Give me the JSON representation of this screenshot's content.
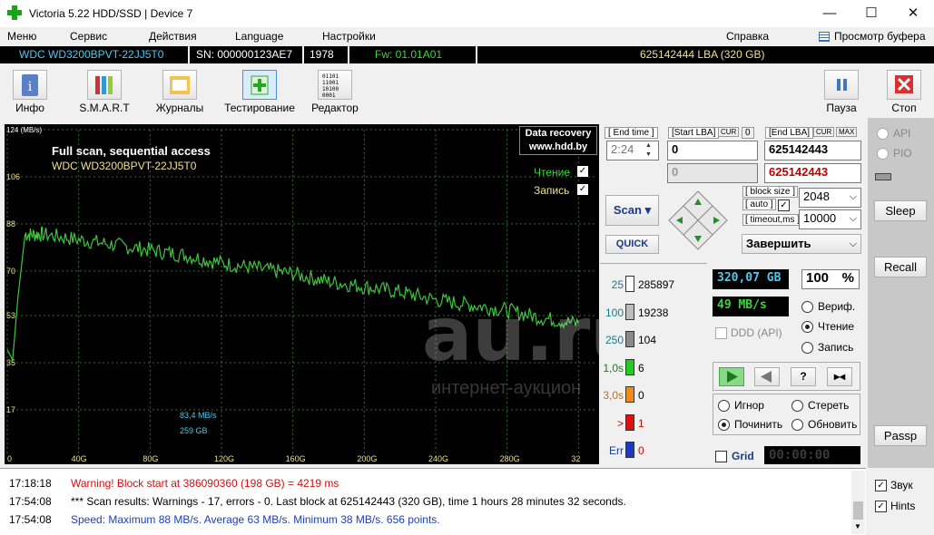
{
  "window": {
    "title": "Victoria 5.22 HDD/SSD | Device 7",
    "minimize": "—",
    "maximize": "☐",
    "close": "✕"
  },
  "menu": {
    "items": [
      "Меню",
      "Сервис",
      "Действия",
      "Language",
      "Настройки"
    ],
    "help": "Справка",
    "buffer": "Просмотр буфера"
  },
  "drive": {
    "model": "WDC WD3200BPVT-22JJ5T0",
    "sn": "SN: 000000123AE7",
    "num": "1978",
    "fw": "Fw: 01.01A01",
    "lba": "625142444 LBA (320 GB)"
  },
  "toolbar": {
    "info": "Инфо",
    "smart": "S.M.A.R.T",
    "logs": "Журналы",
    "test": "Тестирование",
    "editor": "Редактор",
    "pause": "Пауза",
    "stop": "Стоп"
  },
  "graph": {
    "title": "Full scan, sequential access",
    "model": "WDC WD3200BPVT-22JJ5T0",
    "brand1": "Data recovery",
    "brand2": "www.hdd.by",
    "read_label": "Чтение",
    "write_label": "Запись",
    "cur_speed": "83,4 MB/s",
    "cur_pos": "259 GB",
    "ylabel": "124 (MB/s)",
    "yticks": [
      "106",
      "88",
      "70",
      "53",
      "35",
      "17"
    ],
    "xticks": [
      "0",
      "40G",
      "80G",
      "120G",
      "160G",
      "200G",
      "240G",
      "280G",
      "32"
    ],
    "colors": {
      "line": "#3ec43e",
      "grid": "#2f6e2f",
      "text": "#ffffff",
      "axis": "#f0e08a"
    }
  },
  "chart_data": {
    "type": "line",
    "title": "Full scan, sequential access",
    "ylabel": "124 (MB/s)",
    "ylim": [
      0,
      124
    ],
    "x_unit": "GB",
    "x": [
      0,
      3,
      6,
      10,
      20,
      40,
      60,
      80,
      100,
      120,
      140,
      160,
      180,
      200,
      220,
      240,
      260,
      280,
      300,
      320
    ],
    "values": [
      40,
      36,
      60,
      84,
      84,
      82,
      80,
      78,
      76,
      73,
      71,
      69,
      66,
      64,
      62,
      59,
      57,
      55,
      52,
      50
    ],
    "series": [
      {
        "name": "Чтение",
        "values": [
          40,
          36,
          60,
          84,
          84,
          82,
          80,
          78,
          76,
          73,
          71,
          69,
          66,
          64,
          62,
          59,
          57,
          55,
          52,
          50
        ]
      }
    ]
  },
  "panel": {
    "end_time_label": "[ End time ]",
    "end_time": "2:24",
    "start_lba_label": "[Start LBA]",
    "cur": "CUR",
    "zero": "0",
    "end_lba_label": "[End LBA]",
    "max": "MAX",
    "start_lba": "0",
    "end_lba": "625142443",
    "cur_lba": "0",
    "cur_end": "625142443",
    "block_size_label": "[ block size ]",
    "auto_label": "[ auto ]",
    "timeout_label": "[ timeout,ms ]",
    "block_size": "2048",
    "timeout": "10000",
    "scan": "Scan",
    "quick": "QUICK",
    "finish": "Завершить"
  },
  "stats": {
    "rows": [
      {
        "label": "25",
        "value": "285897",
        "color": "#ffffff"
      },
      {
        "label": "100",
        "value": "19238",
        "color": "#bdbdbd"
      },
      {
        "label": "250",
        "value": "104",
        "color": "#8a8a8a"
      },
      {
        "label": "1,0s",
        "value": "6",
        "color": "#22cc22"
      },
      {
        "label": "3,0s",
        "value": "0",
        "color": "#f08a1c"
      },
      {
        "label": ">",
        "value": "1",
        "color": "#e01010"
      },
      {
        "label": "Err",
        "value": "0",
        "color": "#1c3ac4"
      }
    ],
    "size": "320,07 GB",
    "percent": "100",
    "pct_sign": "%",
    "speed": "49 MB/s",
    "ddd": "DDD (API)",
    "verify": "Вериф.",
    "read": "Чтение",
    "write": "Запись",
    "ignore": "Игнор",
    "erase": "Стереть",
    "repair": "Починить",
    "update": "Обновить",
    "grid": "Grid",
    "timer": "00:00:00"
  },
  "side": {
    "api": "API",
    "pio": "PIO",
    "sleep": "Sleep",
    "recall": "Recall",
    "passp": "Passp",
    "sound": "Звук",
    "hints": "Hints"
  },
  "log": [
    {
      "time": "17:18:18",
      "text": "Warning! Block start at 386090360 (198 GB)  = 4219 ms",
      "color": "#d01010"
    },
    {
      "time": "17:54:08",
      "text": "*** Scan results: Warnings - 17, errors - 0. Last block at 625142443 (320 GB), time 1 hours 28 minutes 32 seconds.",
      "color": "#000000"
    },
    {
      "time": "17:54:08",
      "text": "Speed: Maximum 88 MB/s. Average 63 MB/s. Minimum 38 MB/s. 656 points.",
      "color": "#1a3fc0"
    }
  ],
  "watermark": "au.ru",
  "watermark2": "интернет-аукцион"
}
